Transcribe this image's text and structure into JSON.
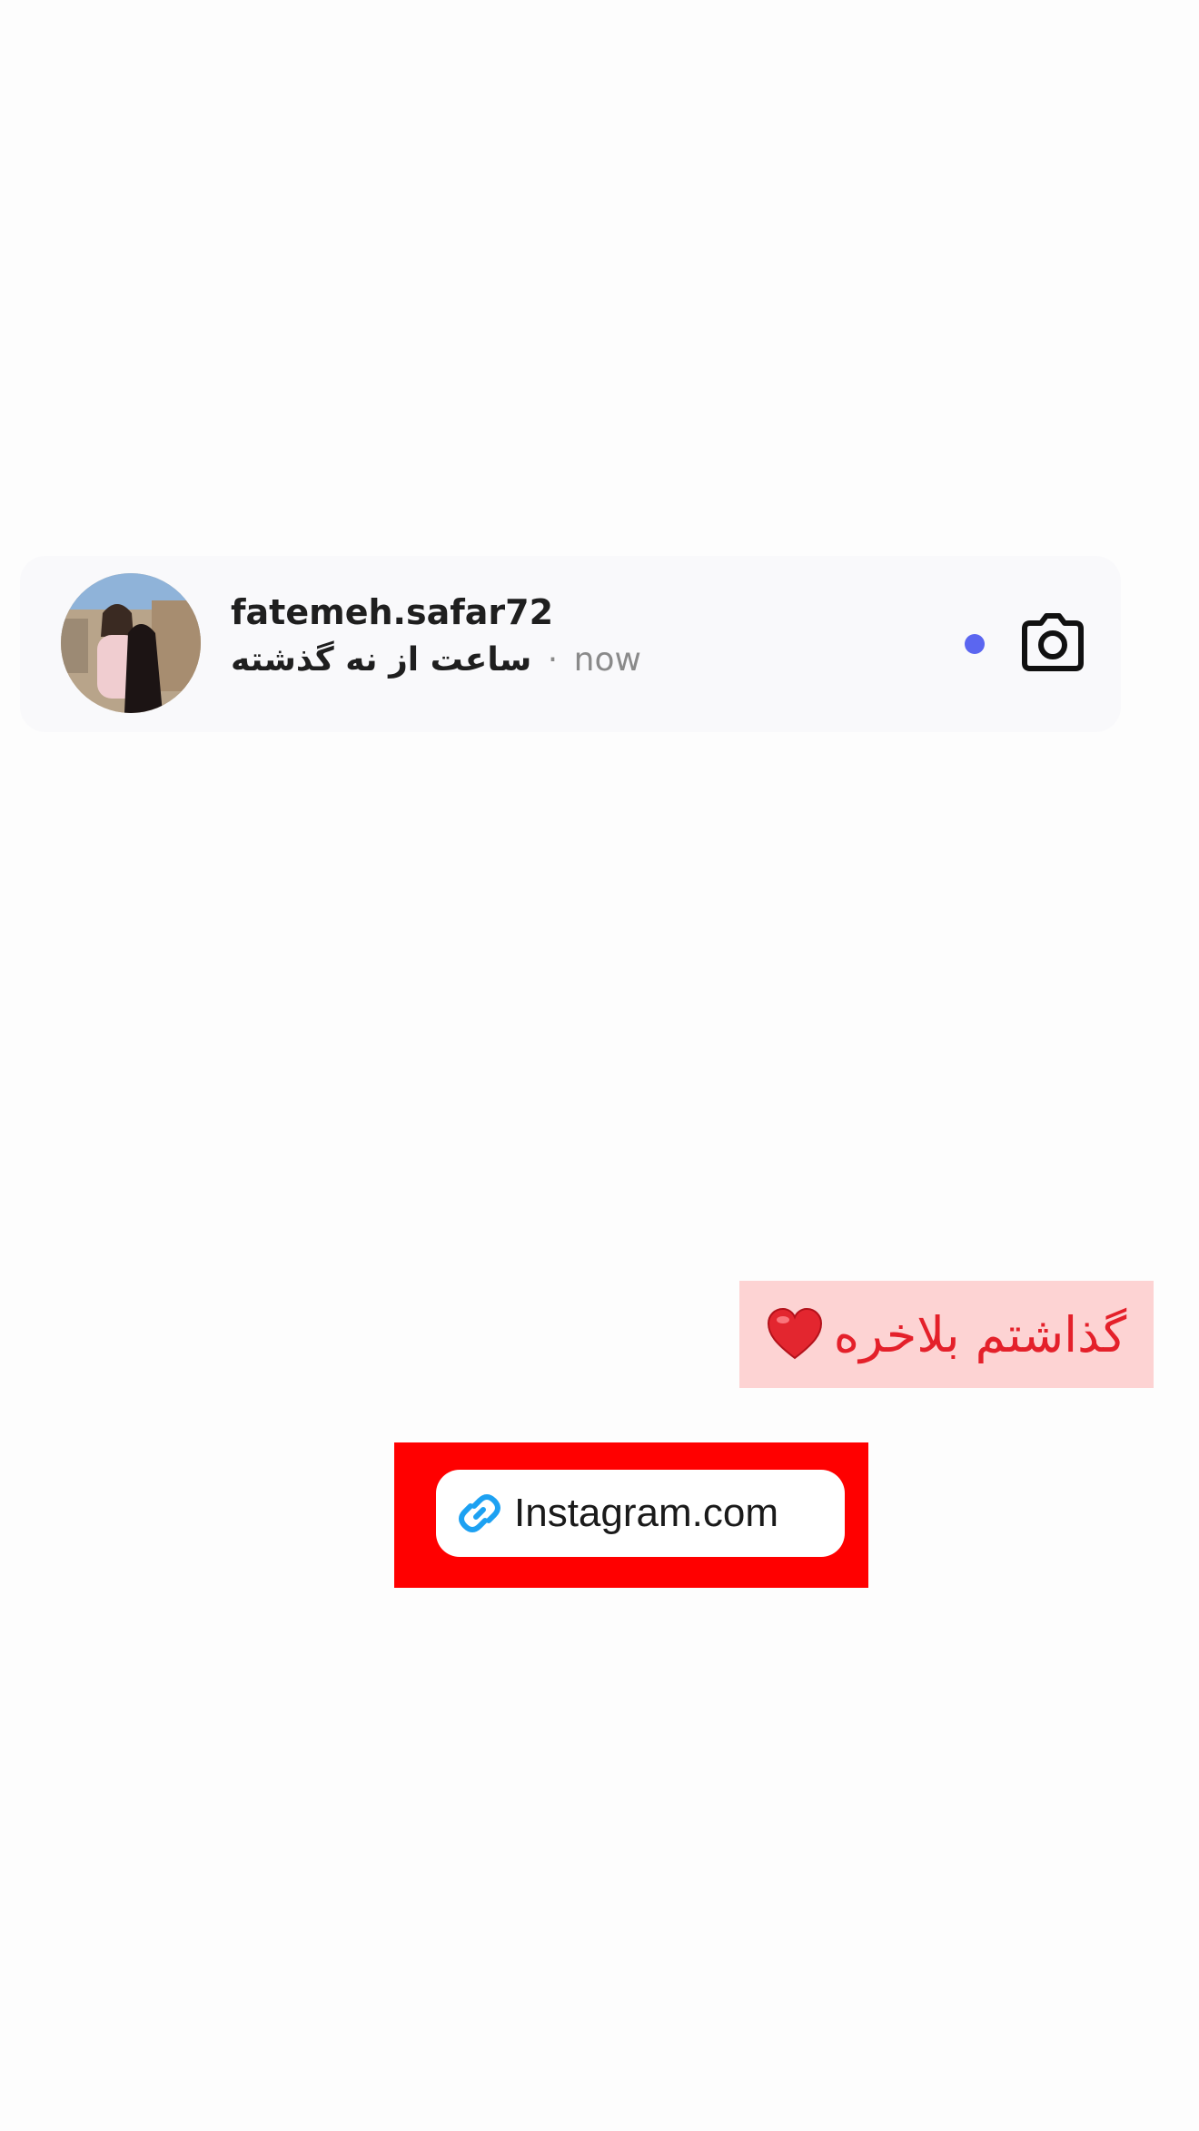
{
  "notification": {
    "username": "fatemeh.safar72",
    "message": "ساعت از نه گذشته",
    "separator": "·",
    "time": "now",
    "avatar_icon": "profile-photo",
    "camera_icon": "camera-icon",
    "unread_dot_color": "#5b66f0"
  },
  "sticker": {
    "text": "گذاشتم بلاخره",
    "emoji_icon": "red-heart-icon",
    "text_color": "#e4202a",
    "background_color": "#fdd3d3"
  },
  "link_sticker": {
    "label": "Instagram.com",
    "icon": "link-icon",
    "icon_color": "#1da1f2",
    "frame_color": "#ff0000"
  }
}
